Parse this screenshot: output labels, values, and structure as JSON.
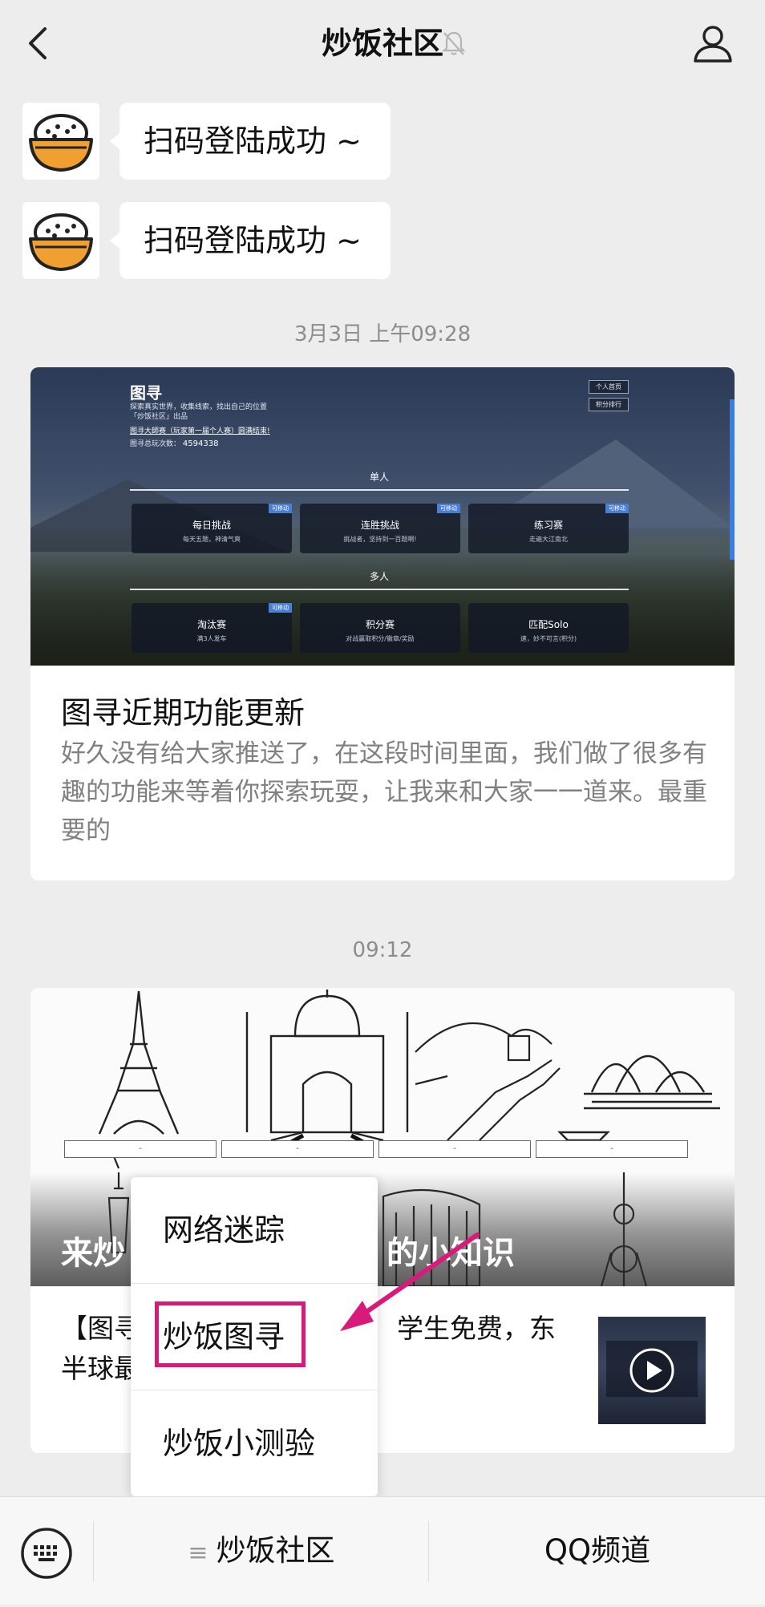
{
  "header": {
    "title": "炒饭社区"
  },
  "messages": [
    {
      "text": "扫码登陆成功 ~"
    },
    {
      "text": "扫码登陆成功 ~"
    }
  ],
  "timestamps": [
    "3月3日 上午09:28",
    "09:12"
  ],
  "article1": {
    "title": "图寻近期功能更新",
    "description": "好久没有给大家推送了，在这段时间里面，我们做了很多有趣的功能来等着你探索玩耍，让我来和大家一一道来。最重要的",
    "cover": {
      "logo": "图寻",
      "intro_line1": "探索真实世界，收集线索，找出自己的位置",
      "intro_line2": "「炒饭社区」出品",
      "link": "图寻大師赛（玩家第一届个人赛）圆满结束!",
      "count_label": "图寻总玩次数：",
      "count_value": "4594338",
      "btn_profile": "个人首页",
      "btn_rank": "积分排行",
      "section_single": "单人",
      "section_multi": "多人",
      "modes": [
        {
          "title": "每日挑战",
          "sub": "每天五题，神清气爽",
          "tag": "可移动"
        },
        {
          "title": "连胜挑战",
          "sub": "挑战者，坚持到一百题啊!",
          "tag": "可移动"
        },
        {
          "title": "练习赛",
          "sub": "走遍大江南北",
          "tag": "可移动"
        },
        {
          "title": "淘汰赛",
          "sub": "满3人发车",
          "tag": "可移动"
        },
        {
          "title": "积分赛",
          "sub": "对战赢取积分/徽章/奖励",
          "tag": ""
        },
        {
          "title": "匹配Solo",
          "sub": "速，妙不可言(积分)",
          "tag": ""
        }
      ]
    }
  },
  "article2": {
    "overlay_text": "来炒",
    "overlay_text_right": "的小知识",
    "body_left": "【图寻",
    "body_right": "学生免费，东",
    "body_line2": "半球最",
    "landmark_labels": [
      "-",
      "-",
      "-",
      "-"
    ]
  },
  "popup_menu": {
    "items": [
      "网络迷踪",
      "炒饭图寻",
      "炒饭小测验"
    ],
    "highlighted_index": 1
  },
  "bottom_bar": {
    "menu1": "炒饭社区",
    "menu2": "QQ频道"
  },
  "colors": {
    "background": "#ededed",
    "highlight": "#d81b7a",
    "avatar_bowl": "#f0a030"
  }
}
